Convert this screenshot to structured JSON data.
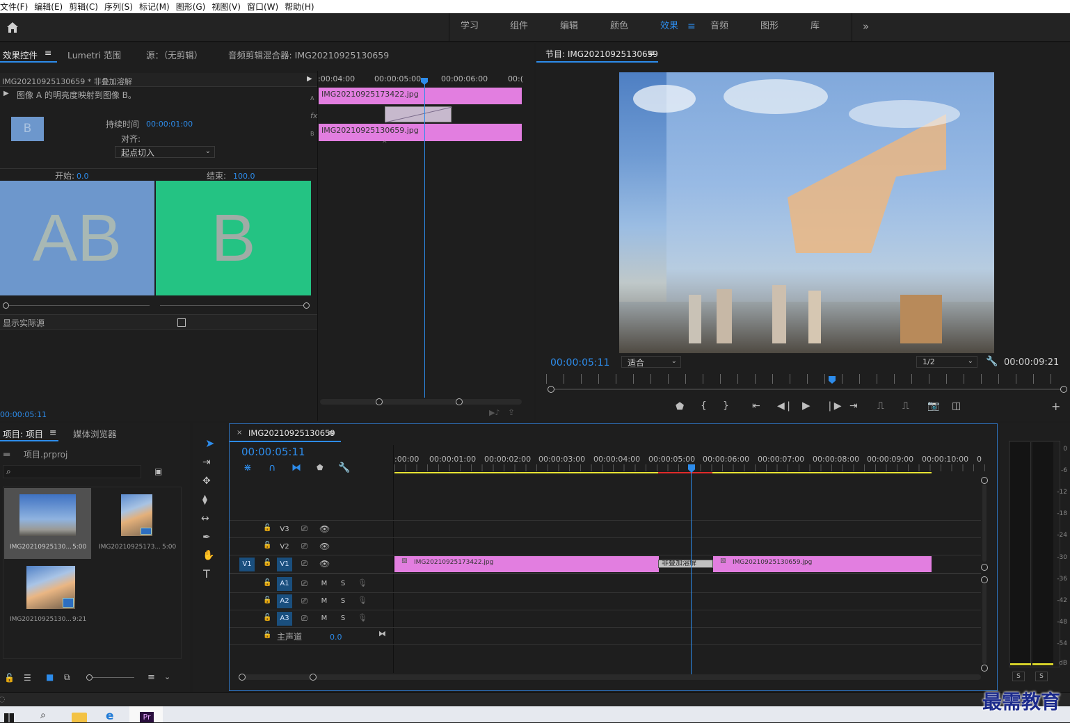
{
  "menubar": [
    "文件(F)",
    "编辑(E)",
    "剪辑(C)",
    "序列(S)",
    "标记(M)",
    "图形(G)",
    "视图(V)",
    "窗口(W)",
    "帮助(H)"
  ],
  "workspaces": [
    "学习",
    "组件",
    "编辑",
    "颜色",
    "效果",
    "音频",
    "图形",
    "库"
  ],
  "workspace_active": "效果",
  "effect_controls": {
    "tabs": [
      "效果控件",
      "Lumetri 范围",
      "源：（无剪辑）",
      "音频剪辑混合器: IMG20210925130659"
    ],
    "clip_header": "IMG20210925130659 * 非叠加溶解",
    "description": "图像 A 的明亮度映射到图像 B。",
    "duration_label": "持续时间",
    "duration_value": "00:00:01:00",
    "align_label": "对齐:",
    "align_value": "起点切入",
    "start_label": "开始:",
    "start_value": "0.0",
    "end_label": "结束:",
    "end_value": "100.0",
    "preview_a": "AB",
    "preview_b": "B",
    "show_actual_sources": "显示实际源",
    "timecode": "00:00:05:11",
    "mini_ruler": [
      ":00:04:00",
      "00:00:05:00",
      "00:00:06:00",
      "00:("
    ],
    "mini_clip_a": "IMG20210925173422.jpg",
    "mini_clip_b": "IMG20210925130659.jpg",
    "track_a": "A",
    "track_fx": "fx",
    "track_b": "B"
  },
  "program": {
    "title": "节目: IMG20210925130659",
    "timecode": "00:00:05:11",
    "fit": "适合",
    "resolution": "1/2",
    "duration": "00:00:09:21"
  },
  "project": {
    "tabs": [
      "项目: 项目",
      "媒体浏览器"
    ],
    "file": "项目.prproj",
    "items": [
      {
        "name": "IMG20210925130...",
        "duration": "5:00"
      },
      {
        "name": "IMG20210925173...",
        "duration": "5:00"
      },
      {
        "name": "IMG20210925130...",
        "duration": "9:21"
      }
    ]
  },
  "timeline": {
    "tab": "IMG20210925130659",
    "timecode": "00:00:05:11",
    "ruler": [
      ":00:00",
      "00:00:01:00",
      "00:00:02:00",
      "00:00:03:00",
      "00:00:04:00",
      "00:00:05:00",
      "00:00:06:00",
      "00:00:07:00",
      "00:00:08:00",
      "00:00:09:00",
      "00:00:10:00",
      "0"
    ],
    "tracks_video": [
      "V3",
      "V2",
      "V1"
    ],
    "tracks_audio": [
      "A1",
      "A2",
      "A3"
    ],
    "source_v1": "V1",
    "m": "M",
    "s": "S",
    "master": "主声道",
    "master_value": "0.0",
    "clip1": "IMG20210925173422.jpg",
    "clip2": "IMG20210925130659.jpg",
    "transition": "非叠加溶解"
  },
  "meter": {
    "scale": [
      "0",
      "-6",
      "-12",
      "-18",
      "-24",
      "-30",
      "-36",
      "-42",
      "-48",
      "-54",
      "dB"
    ],
    "solo": [
      "S",
      "S"
    ]
  },
  "watermark": "最需教育"
}
